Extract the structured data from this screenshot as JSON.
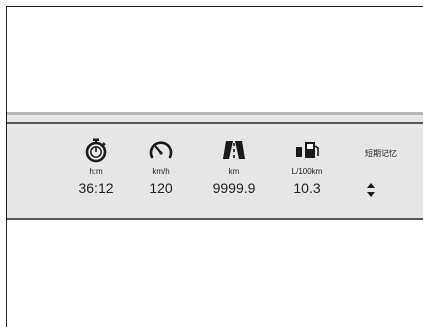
{
  "info_strip": {
    "trip_time": {
      "icon": "stopwatch-icon",
      "unit": "h:m",
      "value": "36:12"
    },
    "speed": {
      "icon": "speedometer-icon",
      "unit": "km/h",
      "value": "120"
    },
    "distance": {
      "icon": "road-distance-icon",
      "unit": "km",
      "value": "9999.9"
    },
    "fuel_consumption": {
      "icon": "fuel-pump-icon",
      "unit": "L/100km",
      "value": "10.3"
    },
    "memory": {
      "label": "短期记忆",
      "control_icon": "up-down-arrows-icon"
    }
  }
}
